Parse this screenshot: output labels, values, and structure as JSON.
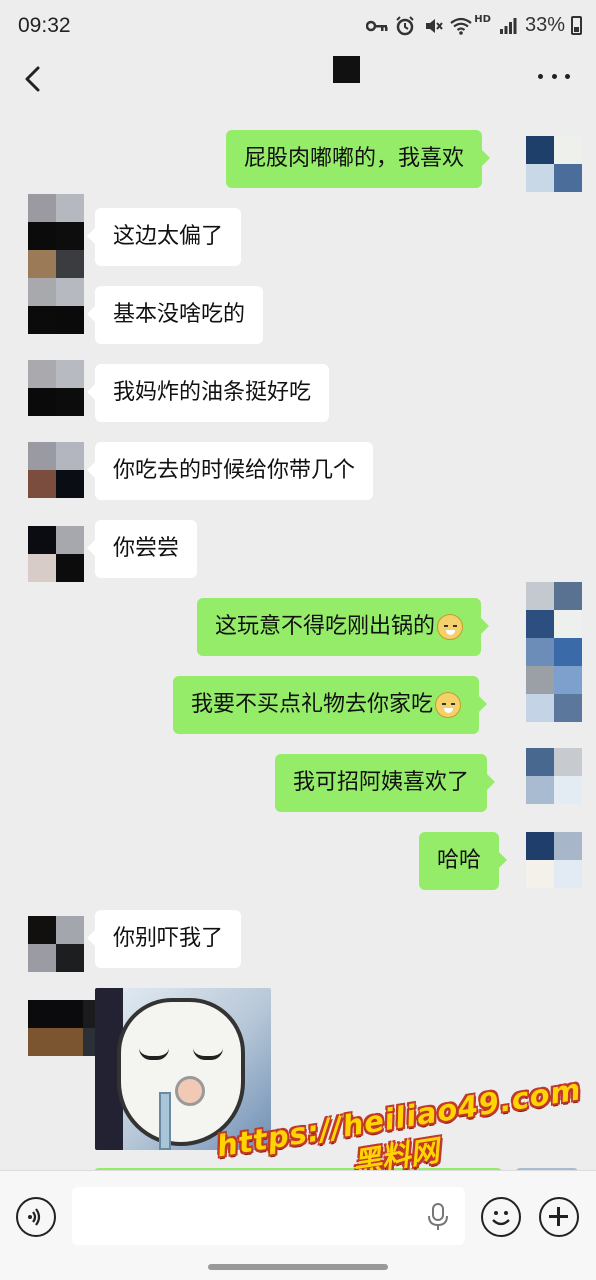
{
  "status_bar": {
    "time": "09:32",
    "battery": "33%",
    "icons": [
      "key-icon",
      "alarm-icon",
      "mute-icon",
      "wifi-icon",
      "hd-icon",
      "signal-icon",
      "battery-icon"
    ],
    "hd_label": "HD"
  },
  "nav": {
    "back_icon": "chevron-left-icon",
    "more_icon": "more-dots-icon"
  },
  "messages": [
    {
      "side": "out",
      "text": "屁股肉嘟嘟的，我喜欢"
    },
    {
      "side": "in",
      "text": "这边太偏了"
    },
    {
      "side": "in",
      "text": "基本没啥吃的"
    },
    {
      "side": "in",
      "text": "我妈炸的油条挺好吃"
    },
    {
      "side": "in",
      "text": "你吃去的时候给你带几个"
    },
    {
      "side": "in",
      "text": "你尝尝"
    },
    {
      "side": "out",
      "text": "这玩意不得吃刚出锅的",
      "emoji": "doge-emoji"
    },
    {
      "side": "out",
      "text": "我要不买点礼物去你家吃",
      "emoji": "doge-emoji"
    },
    {
      "side": "out",
      "text": "我可招阿姨喜欢了"
    },
    {
      "side": "out",
      "text": "哈哈"
    },
    {
      "side": "in",
      "text": "你别吓我了"
    },
    {
      "side": "in",
      "type": "sticker",
      "sticker": "panda-face-sticker"
    }
  ],
  "watermark": {
    "url": "https://heiliao49.com",
    "label": "黑料网"
  },
  "input_bar": {
    "voice_icon": "voice-icon",
    "mic_icon": "mic-icon",
    "emoji_icon": "emoji-icon",
    "plus_icon": "plus-icon"
  },
  "colors": {
    "background": "#ededed",
    "incoming_bubble": "#ffffff",
    "outgoing_bubble": "#95ec69",
    "watermark_fill": "#ffd400",
    "watermark_outline": "#c0392b"
  }
}
